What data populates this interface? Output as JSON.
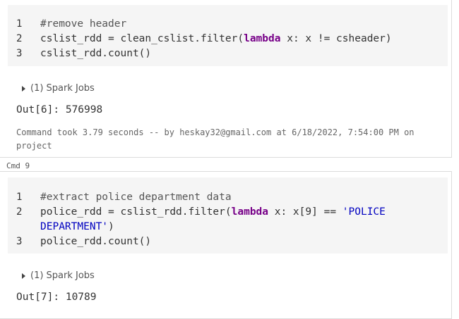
{
  "cell_top": {
    "lines": [
      {
        "num": "1",
        "comment": "#remove header"
      },
      {
        "num": "2",
        "pre": "cslist_rdd = clean_cslist.filter(",
        "kw": "lambda",
        "post": " x: x != csheader)"
      },
      {
        "num": "3",
        "text": "cslist_rdd.count()"
      }
    ],
    "jobs_label": "(1) Spark Jobs",
    "output": "Out[6]: 576998",
    "meta_line1": "Command took 3.79 seconds -- by heskay32@gmail.com at 6/18/2022, 7:54:00 PM on",
    "meta_line2": "project"
  },
  "cmd_label": "Cmd 9",
  "cell_bottom": {
    "lines": [
      {
        "num": "1",
        "comment": "#extract police department data"
      },
      {
        "num": "2",
        "pre": "police_rdd = cslist_rdd.filter(",
        "kw": "lambda",
        "mid": " x: x[9] == ",
        "str1": "'POLICE",
        "str2": "DEPARTMENT'",
        "post2": ")"
      },
      {
        "num": "3",
        "text": "police_rdd.count()"
      }
    ],
    "jobs_label": "(1) Spark Jobs",
    "output": "Out[7]: 10789"
  }
}
